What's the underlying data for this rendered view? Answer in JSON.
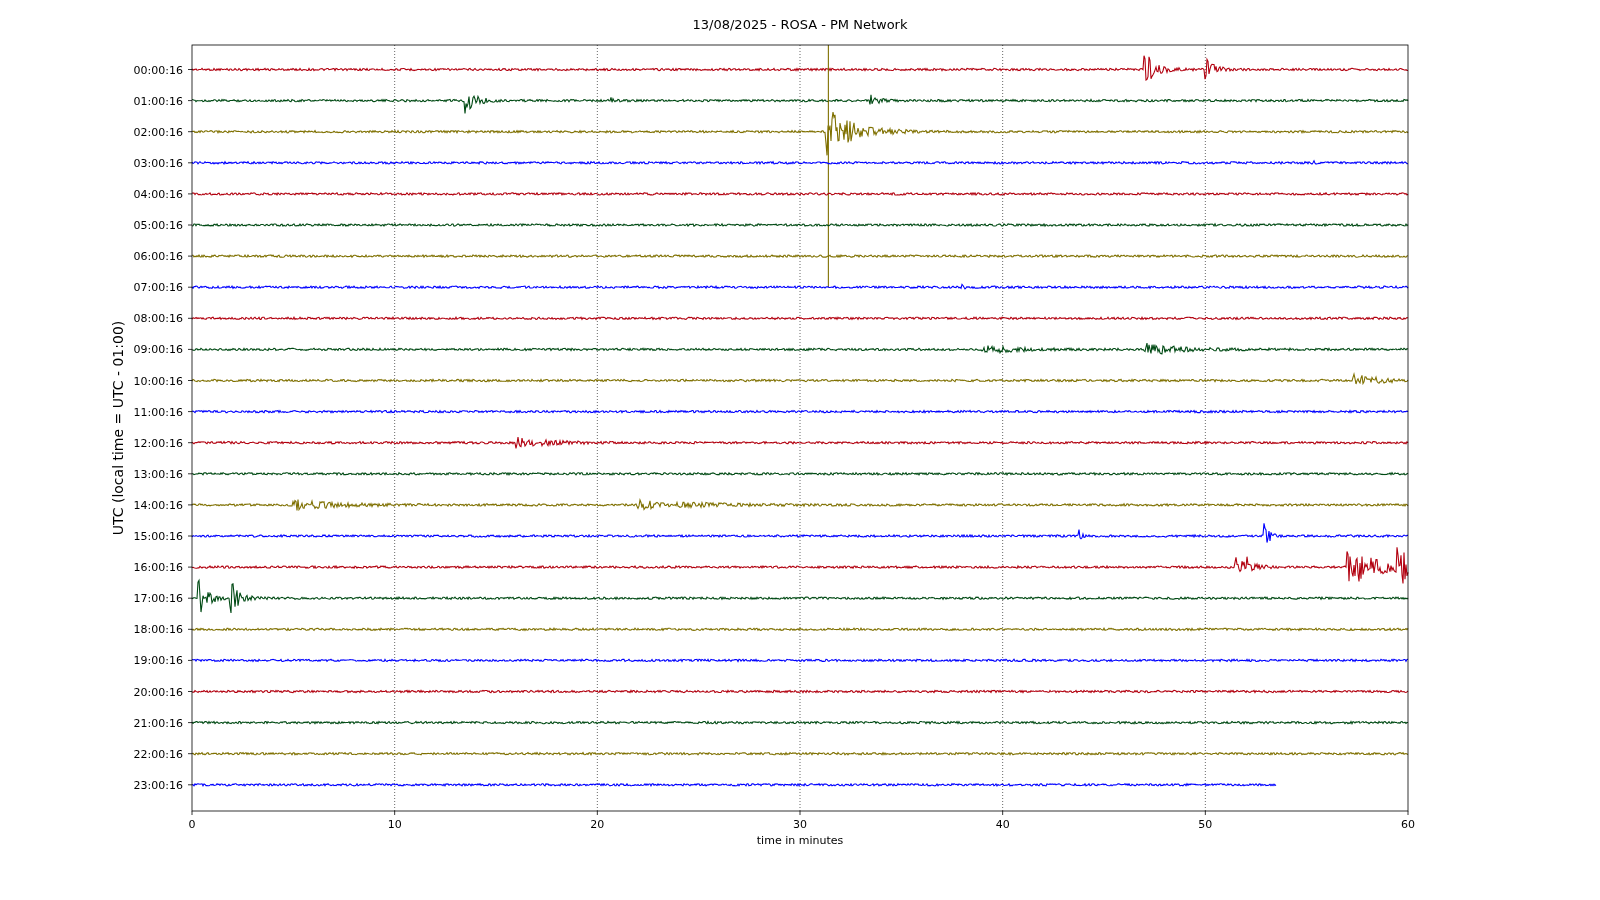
{
  "figure": {
    "title": "13/08/2025 - ROSA - PM Network",
    "xlabel": "time in minutes",
    "ylabel": "UTC (local time = UTC - 01:00)",
    "xticks": [
      "0",
      "10",
      "20",
      "30",
      "40",
      "50",
      "60"
    ],
    "traces": [
      {
        "label": "00:00:16",
        "color": "#b2000f"
      },
      {
        "label": "01:00:16",
        "color": "#004a14"
      },
      {
        "label": "02:00:16",
        "color": "#7f7000"
      },
      {
        "label": "03:00:16",
        "color": "#0000ff"
      },
      {
        "label": "04:00:16",
        "color": "#b2000f"
      },
      {
        "label": "05:00:16",
        "color": "#004a14"
      },
      {
        "label": "06:00:16",
        "color": "#7f7000"
      },
      {
        "label": "07:00:16",
        "color": "#0000ff"
      },
      {
        "label": "08:00:16",
        "color": "#b2000f"
      },
      {
        "label": "09:00:16",
        "color": "#004a14"
      },
      {
        "label": "10:00:16",
        "color": "#7f7000"
      },
      {
        "label": "11:00:16",
        "color": "#0000ff"
      },
      {
        "label": "12:00:16",
        "color": "#b2000f"
      },
      {
        "label": "13:00:16",
        "color": "#004a14"
      },
      {
        "label": "14:00:16",
        "color": "#7f7000"
      },
      {
        "label": "15:00:16",
        "color": "#0000ff"
      },
      {
        "label": "16:00:16",
        "color": "#b2000f"
      },
      {
        "label": "17:00:16",
        "color": "#004a14"
      },
      {
        "label": "18:00:16",
        "color": "#7f7000"
      },
      {
        "label": "19:00:16",
        "color": "#0000ff"
      },
      {
        "label": "20:00:16",
        "color": "#b2000f"
      },
      {
        "label": "21:00:16",
        "color": "#004a14"
      },
      {
        "label": "22:00:16",
        "color": "#7f7000"
      },
      {
        "label": "23:00:16",
        "color": "#0000ff"
      }
    ]
  }
}
